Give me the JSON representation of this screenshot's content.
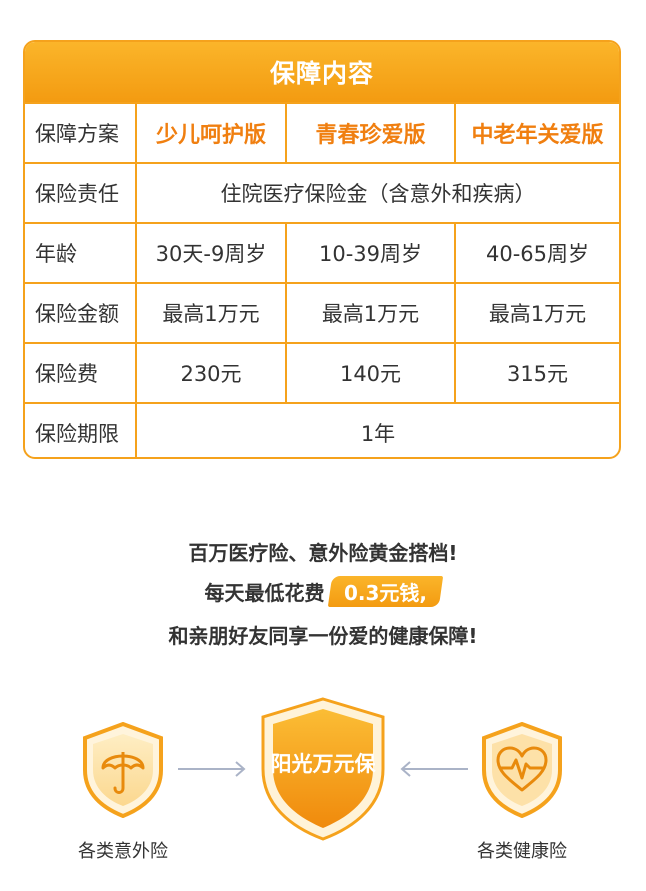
{
  "table": {
    "title": "保障内容",
    "rows": [
      {
        "label": "保障方案",
        "c1": "少儿呵护版",
        "c2": "青春珍爱版",
        "c3": "中老年关爱版"
      },
      {
        "label": "保险责任",
        "span": "住院医疗保险金（含意外和疾病）"
      },
      {
        "label": "年龄",
        "c1": "30天-9周岁",
        "c2": "10-39周岁",
        "c3": "40-65周岁"
      },
      {
        "label": "保险金额",
        "c1": "最高1万元",
        "c2": "最高1万元",
        "c3": "最高1万元"
      },
      {
        "label": "保险费",
        "c1": "230元",
        "c2": "140元",
        "c3": "315元"
      },
      {
        "label": "保险期限",
        "span": "1年"
      }
    ]
  },
  "slogan": {
    "line1": "百万医疗险、意外险黄金搭档!",
    "line2_prefix": "每天最低花费",
    "line2_badge": "0.3元钱,",
    "line3": "和亲朋好友同享一份爱的健康保障!"
  },
  "combo": {
    "left_label": "各类意外险",
    "center_label": "阳光万元保",
    "right_label": "各类健康险",
    "left_icon": "umbrella-icon",
    "right_icon": "heart-pulse-icon"
  },
  "colors": {
    "accent": "#f5a21c",
    "plan_text": "#f07f10"
  }
}
